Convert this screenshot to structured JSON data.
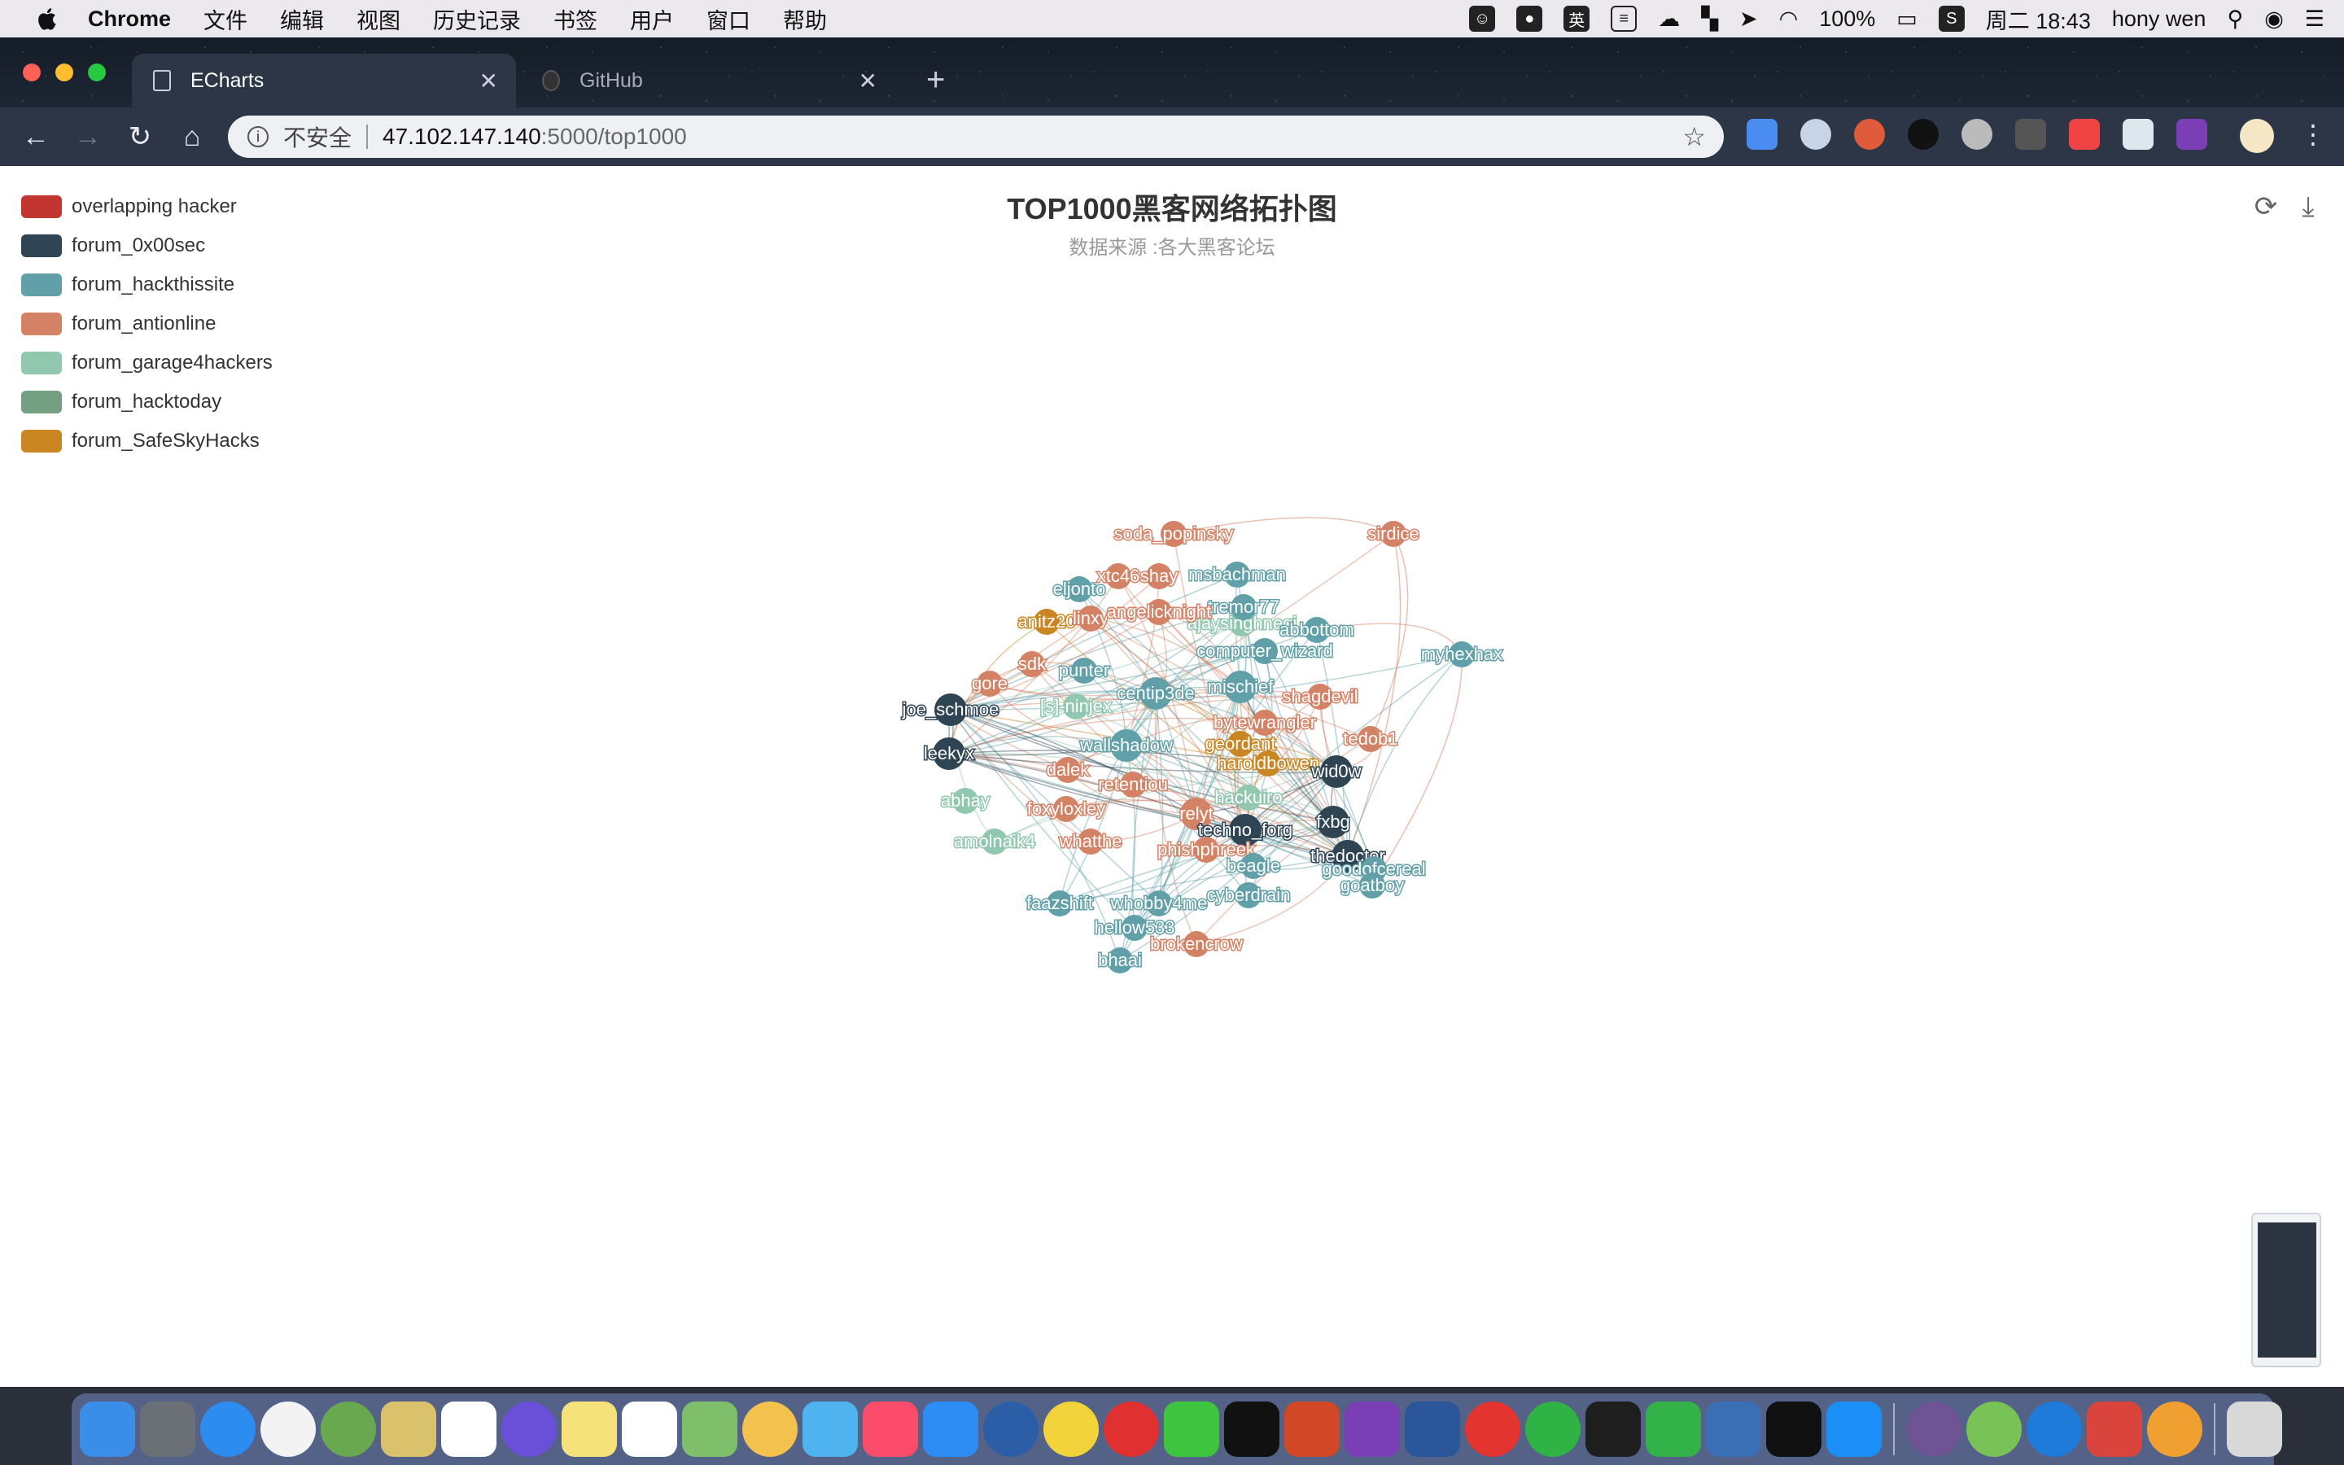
{
  "menubar": {
    "app_name": "Chrome",
    "menus": [
      "文件",
      "编辑",
      "视图",
      "历史记录",
      "书签",
      "用户",
      "窗口",
      "帮助"
    ],
    "status": {
      "battery": "100%",
      "clock": "周二 18:43",
      "user": "hony wen",
      "input_method": "英"
    }
  },
  "browser": {
    "tabs": [
      {
        "label": "ECharts",
        "active": true
      },
      {
        "label": "GitHub",
        "active": false
      }
    ],
    "address": {
      "security_label": "不安全",
      "host": "47.102.147.140",
      "path": ":5000/top1000"
    }
  },
  "chart": {
    "title": "TOP1000黑客网络拓扑图",
    "subtitle": "数据来源 :各大黑客论坛",
    "legend": [
      {
        "name": "overlapping hacker",
        "color": "#c23531"
      },
      {
        "name": "forum_0x00sec",
        "color": "#2f4554"
      },
      {
        "name": "forum_hackthissite",
        "color": "#61a0a8"
      },
      {
        "name": "forum_antionline",
        "color": "#d48265"
      },
      {
        "name": "forum_garage4hackers",
        "color": "#91c7ae"
      },
      {
        "name": "forum_hacktoday",
        "color": "#749f83"
      },
      {
        "name": "forum_SafeSkyHacks",
        "color": "#ca8622"
      }
    ]
  },
  "chart_data": {
    "type": "graph",
    "title": "TOP1000黑客网络拓扑图",
    "subtitle": "数据来源 :各大黑客论坛",
    "nodes": [
      {
        "name": "soda_popinsky",
        "category": "forum_antionline"
      },
      {
        "name": "sirdice",
        "category": "forum_antionline"
      },
      {
        "name": "msbachman",
        "category": "forum_hackthissite"
      },
      {
        "name": "xtc46",
        "category": "forum_antionline"
      },
      {
        "name": "shay",
        "category": "forum_antionline"
      },
      {
        "name": "eljonto",
        "category": "forum_hackthissite"
      },
      {
        "name": "ajaysinghnegi",
        "category": "forum_garage4hackers"
      },
      {
        "name": "tremor77",
        "category": "forum_hackthissite"
      },
      {
        "name": "anitz20",
        "category": "forum_SafeSkyHacks"
      },
      {
        "name": "linxy",
        "category": "forum_antionline"
      },
      {
        "name": "angelicknight",
        "category": "forum_antionline"
      },
      {
        "name": "abbottom",
        "category": "forum_hackthissite"
      },
      {
        "name": "myhexhax",
        "category": "forum_hackthissite"
      },
      {
        "name": "computer_wizard",
        "category": "forum_hackthissite"
      },
      {
        "name": "sdk",
        "category": "forum_antionline"
      },
      {
        "name": "punter",
        "category": "forum_hackthissite"
      },
      {
        "name": "gore",
        "category": "forum_antionline"
      },
      {
        "name": "mischief",
        "category": "forum_hackthissite"
      },
      {
        "name": "shagdevil",
        "category": "forum_antionline"
      },
      {
        "name": "joe_schmoe",
        "category": "forum_0x00sec"
      },
      {
        "name": "[s]-ninjex",
        "category": "forum_garage4hackers"
      },
      {
        "name": "centip3de",
        "category": "forum_hackthissite"
      },
      {
        "name": "bytewrangler",
        "category": "forum_antionline"
      },
      {
        "name": "tedob1",
        "category": "forum_antionline"
      },
      {
        "name": "leekyx",
        "category": "forum_0x00sec"
      },
      {
        "name": "wallshadow",
        "category": "forum_hackthissite"
      },
      {
        "name": "geordant",
        "category": "forum_SafeSkyHacks"
      },
      {
        "name": "haroldbowen",
        "category": "forum_SafeSkyHacks"
      },
      {
        "name": "dalek",
        "category": "forum_antionline"
      },
      {
        "name": "retentiou",
        "category": "forum_antionline"
      },
      {
        "name": "wid0w",
        "category": "forum_0x00sec"
      },
      {
        "name": "abhay",
        "category": "forum_garage4hackers"
      },
      {
        "name": "hackuiro",
        "category": "forum_garage4hackers"
      },
      {
        "name": "foxyloxley",
        "category": "forum_antionline"
      },
      {
        "name": "relyt",
        "category": "forum_antionline"
      },
      {
        "name": "techno_forg",
        "category": "forum_0x00sec"
      },
      {
        "name": "fxbg",
        "category": "forum_0x00sec"
      },
      {
        "name": "amolnaik4",
        "category": "forum_garage4hackers"
      },
      {
        "name": "whatthe",
        "category": "forum_antionline"
      },
      {
        "name": "phishphreek",
        "category": "forum_antionline"
      },
      {
        "name": "thedoctor",
        "category": "forum_0x00sec"
      },
      {
        "name": "beagle",
        "category": "forum_hackthissite"
      },
      {
        "name": "goodofcereal",
        "category": "forum_hackthissite"
      },
      {
        "name": "goatboy",
        "category": "forum_hackthissite"
      },
      {
        "name": "cyberdrain",
        "category": "forum_hackthissite"
      },
      {
        "name": "faazshift",
        "category": "forum_hackthissite"
      },
      {
        "name": "whobby4me",
        "category": "forum_hackthissite"
      },
      {
        "name": "hellow533",
        "category": "forum_hackthissite"
      },
      {
        "name": "brokencrow",
        "category": "forum_antionline"
      },
      {
        "name": "bhaai",
        "category": "forum_hackthissite"
      }
    ]
  },
  "dock": {
    "icons": [
      "finder-icon",
      "launchpad-icon",
      "safari-icon",
      "chrome-icon",
      "app-icon",
      "preview-icon",
      "calendar-icon",
      "siri-icon",
      "notes-icon",
      "reminders-icon",
      "maps-icon",
      "photos-icon",
      "messages-icon",
      "music-icon",
      "appstore-icon",
      "qq-icon",
      "app-icon",
      "netease-music-icon",
      "wechat-icon",
      "qq-penguin-icon",
      "powerpoint-icon",
      "onenote-icon",
      "word-icon",
      "app-icon",
      "app-icon",
      "pycharm-icon",
      "hbuilder-icon",
      "vscode-icon",
      "intellij-icon",
      "xcode-icon",
      "github-desktop-icon",
      "android-studio-icon",
      "app-icon",
      "parallels-icon",
      "app-icon",
      "trash-icon"
    ]
  }
}
